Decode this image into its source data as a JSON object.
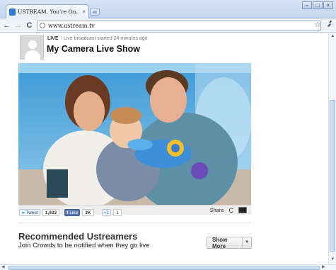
{
  "browser": {
    "tab_title": "USTREAM, You're On. Free L",
    "tab_close": "×",
    "url": "www.ustream.tv",
    "back": "←",
    "forward": "→",
    "reload": "C",
    "star": "☆",
    "wrench": "🔧",
    "window_controls": [
      "–",
      "□",
      "×"
    ]
  },
  "broadcast": {
    "live_label": "LIVE",
    "live_status": "- Live broadcast started 24 minutes ago",
    "title": "My Camera Live Show"
  },
  "player": {
    "share_label": "Share",
    "refresh_icon": "C"
  },
  "social": {
    "tweet_label": "Tweet",
    "tweet_count": "1,933",
    "like_label": "Like",
    "like_count": "3K",
    "plusone_label": "+1",
    "plusone_count": "1"
  },
  "recommended": {
    "title": "Recommended Ustreamers",
    "subtitle": "Join Crowds to be notified when they go live",
    "show_more_label": "Show More",
    "dropdown_icon": "▼"
  },
  "colors": {
    "accent": "#2a7ad6",
    "facebook": "#3b5998"
  }
}
